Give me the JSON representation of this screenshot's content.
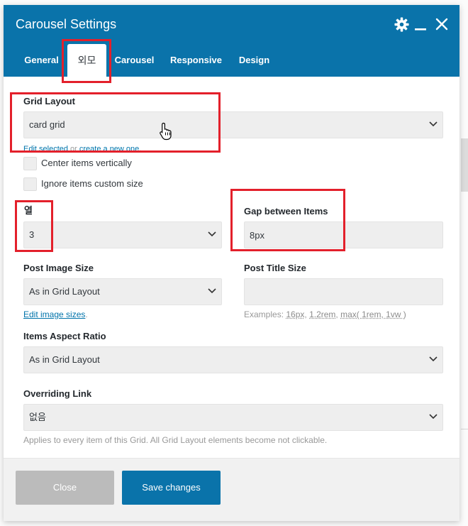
{
  "window": {
    "title": "Carousel Settings"
  },
  "header_icons": {
    "settings": "gear-icon",
    "minimize": "minimize-icon",
    "close": "close-icon"
  },
  "tabs": [
    {
      "label": "General",
      "active": false
    },
    {
      "label": "외모",
      "active": true
    },
    {
      "label": "Carousel",
      "active": false
    },
    {
      "label": "Responsive",
      "active": false
    },
    {
      "label": "Design",
      "active": false
    }
  ],
  "grid_layout": {
    "label": "Grid Layout",
    "value": "card grid",
    "help": {
      "edit_link": "Edit selected",
      "or": " or ",
      "create_link": "create a new one",
      "end": "."
    }
  },
  "checkboxes": [
    {
      "label": "Center items vertically",
      "checked": false
    },
    {
      "label": "Ignore items custom size",
      "checked": false
    }
  ],
  "columns": {
    "label": "열",
    "value": "3"
  },
  "gap": {
    "label": "Gap between Items",
    "value": "8px"
  },
  "post_image_size": {
    "label": "Post Image Size",
    "value": "As in Grid Layout",
    "link": "Edit image sizes",
    "link_suffix": "."
  },
  "post_title_size": {
    "label": "Post Title Size",
    "value": "",
    "examples_prefix": "Examples: ",
    "examples": [
      "16px",
      "1.2rem",
      "max( 1rem, 1vw )"
    ],
    "examples_separator": ", "
  },
  "aspect_ratio": {
    "label": "Items Aspect Ratio",
    "value": "As in Grid Layout"
  },
  "overriding_link": {
    "label": "Overriding Link",
    "value": "없음",
    "help": "Applies to every item of this Grid. All Grid Layout elements become not clickable."
  },
  "footer": {
    "close_label": "Close",
    "save_label": "Save changes"
  },
  "colors": {
    "accent": "#0a73aa",
    "link": "#0073aa",
    "close_button": "#bbbbbb",
    "annotation": "#e3202b",
    "field_bg": "#eeeeee"
  },
  "cursor": "hand-pointer-icon"
}
